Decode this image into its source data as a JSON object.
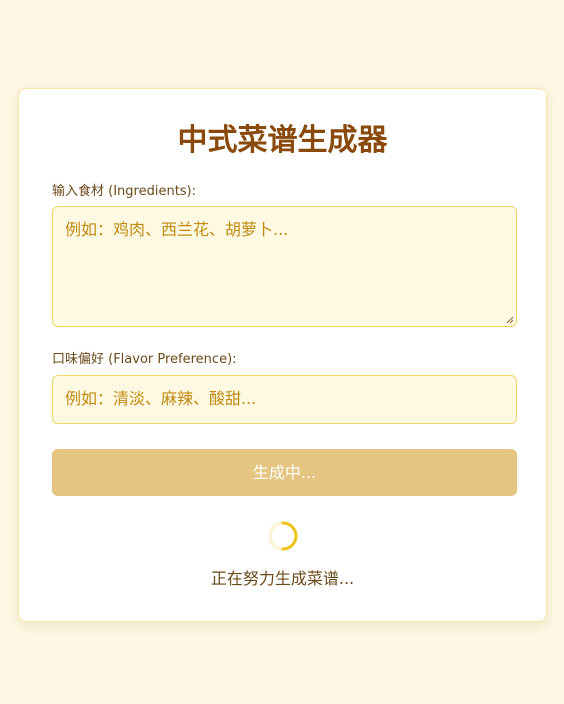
{
  "app": {
    "title": "中式菜谱生成器"
  },
  "form": {
    "ingredients_label": "输入食材 (Ingredients):",
    "ingredients_placeholder": "例如：鸡肉、西兰花、胡萝卜...",
    "ingredients_value": "",
    "flavor_label": "口味偏好 (Flavor Preference):",
    "flavor_placeholder": "例如：清淡、麻辣、酸甜...",
    "flavor_value": "",
    "submit_label": "生成中...",
    "submit_disabled": true
  },
  "status": {
    "loading_text": "正在努力生成菜谱..."
  },
  "colors": {
    "background": "#fdf8e6",
    "title": "#8a4a0b",
    "accent_border": "#f1d66a",
    "placeholder": "#c18a12",
    "button_disabled": "#e4c582",
    "spinner": "#f0c419"
  },
  "icons": {
    "spinner": "loading-spinner-icon",
    "resize": "resize-handle-icon"
  }
}
